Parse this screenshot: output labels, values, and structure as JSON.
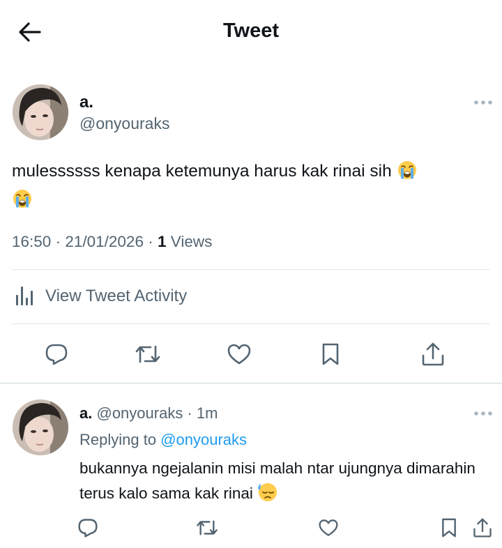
{
  "header": {
    "title": "Tweet",
    "back_icon": "arrow-left-icon"
  },
  "main_tweet": {
    "name": "a.",
    "handle": "@onyouraks",
    "text": "mulessssss kenapa ketemunya harus kak rinai sih",
    "emojis": [
      "loudly-crying-face",
      "loudly-crying-face"
    ],
    "time": "16:50",
    "date": "21/01/2026",
    "views_count": "1",
    "views_label": "Views",
    "activity_label": "View Tweet Activity",
    "actions": [
      "reply-icon",
      "retweet-icon",
      "like-icon",
      "bookmark-icon",
      "share-icon"
    ]
  },
  "reply": {
    "name": "a.",
    "handle": "@onyouraks",
    "time_ago": "1m",
    "replying_to_label": "Replying to",
    "replying_to_handle": "@onyouraks",
    "text": "bukannya ngejalanin misi malah ntar ujungnya dimarahin terus kalo sama kak rinai",
    "emoji": "downcast-face-with-sweat"
  },
  "colors": {
    "text_primary": "#0f1419",
    "text_secondary": "#536471",
    "link": "#1d9bf0",
    "divider": "#e1e6ea"
  }
}
